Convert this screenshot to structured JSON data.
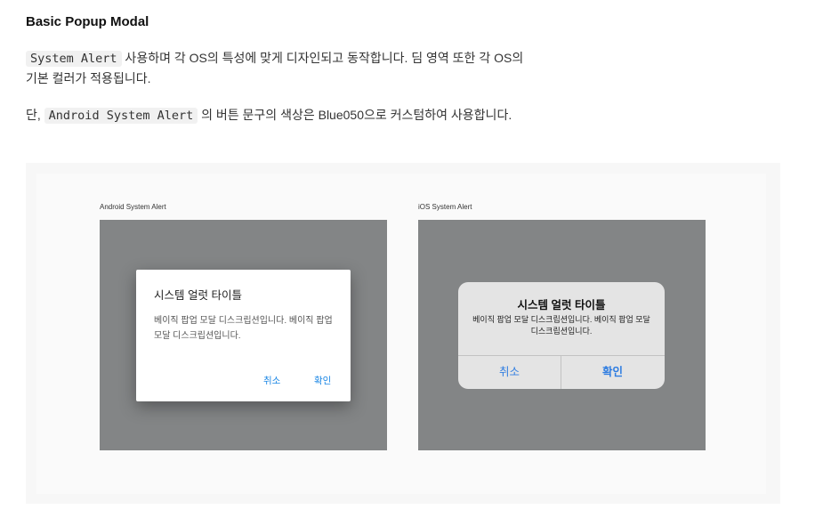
{
  "heading": "Basic Popup Modal",
  "paragraph1": {
    "code": "System Alert",
    "text": " 사용하며 각 OS의 특성에 맞게 디자인되고 동작합니다. 딤 영역 또한 각 OS의 기본 컬러가 적용됩니다."
  },
  "paragraph2": {
    "prefix": "단, ",
    "code": "Android System Alert",
    "text": " 의 버튼 문구의 색상은 Blue050으로 커스텀하여 사용합니다."
  },
  "android": {
    "caption": "Android System Alert",
    "dialog_title": "시스템 얼럿 타이틀",
    "dialog_desc": "베이직 팝업 모달 디스크립션입니다. 베이직 팝업 모달 디스크립션입니다.",
    "cancel_label": "취소",
    "ok_label": "확인",
    "button_color": "#1e88e5"
  },
  "ios": {
    "caption": "iOS System Alert",
    "dialog_title": "시스템 얼럿 타이틀",
    "dialog_desc": "베이직 팝업 모달 디스크립션입니다. 베이직 팝업 모달 디스크립션입니다.",
    "cancel_label": "취소",
    "ok_label": "확인",
    "button_color": "#2f7de1"
  },
  "colors": {
    "dim": "#838586",
    "panel_bg": "#f7f7f7"
  }
}
